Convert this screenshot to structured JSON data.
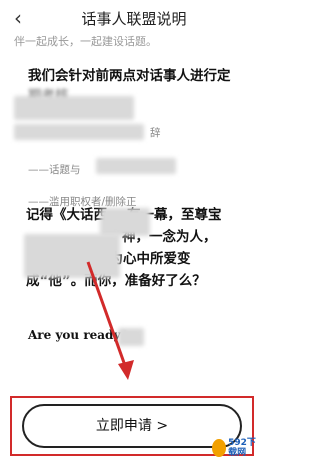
{
  "header": {
    "back_icon": "chevron-left-icon",
    "title": "话事人联盟说明"
  },
  "content": {
    "faded_line": "伴一起成长，一起建设话题。",
    "para1": "我们会针对前两点对话事人进行定",
    "para1_cont": "期考核",
    "rule_1_tail": "辞",
    "rule_2": "——话题与",
    "rule_3": "——滥用职权者/删除正",
    "para2_line1_a": "记得《大话西",
    "para2_line1_b": "有一幕，至尊宝",
    "para2_line2": "神，一念为人，",
    "para2_line3": "愿为心中所爱变",
    "para2_line4": "成“他”。而你，准备好了么？",
    "ready": "Are you ready",
    "ready_tail": "?"
  },
  "apply_button": {
    "label": "立即申请 >"
  },
  "annotation": {
    "frame_color": "#d22a2a",
    "arrow_color": "#d22a2a"
  },
  "watermark": {
    "text_top": "592下载网"
  }
}
